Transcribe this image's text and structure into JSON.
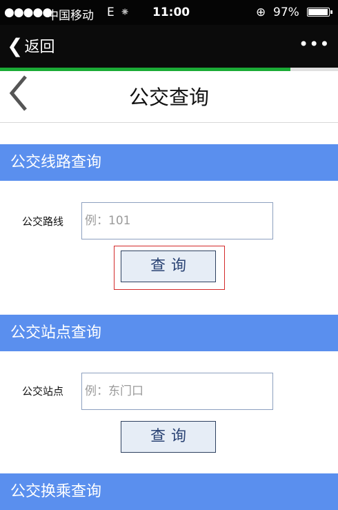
{
  "status_bar": {
    "signal": "●●●●●",
    "carrier": "中国移动",
    "network": "E",
    "activity": "⁕",
    "time": "11:00",
    "lock_icon": "⊕",
    "battery_pct": "97%",
    "battery_level": 0.97
  },
  "nav": {
    "back_chevron": "❮",
    "back_label": "返回",
    "more": "•••"
  },
  "load_progress": 0.86,
  "header": {
    "title": "公交查询"
  },
  "sections": {
    "route": {
      "heading": "公交线路查询",
      "field_label": "公交路线",
      "placeholder": "例：101",
      "button_label": "查询"
    },
    "stop": {
      "heading": "公交站点查询",
      "field_label": "公交站点",
      "placeholder": "例：东门口",
      "button_label": "查询"
    },
    "transfer": {
      "heading": "公交换乘查询"
    }
  },
  "colors": {
    "section_bar": "#5a8fee",
    "progress": "#1bab36",
    "highlight": "#d32828"
  }
}
